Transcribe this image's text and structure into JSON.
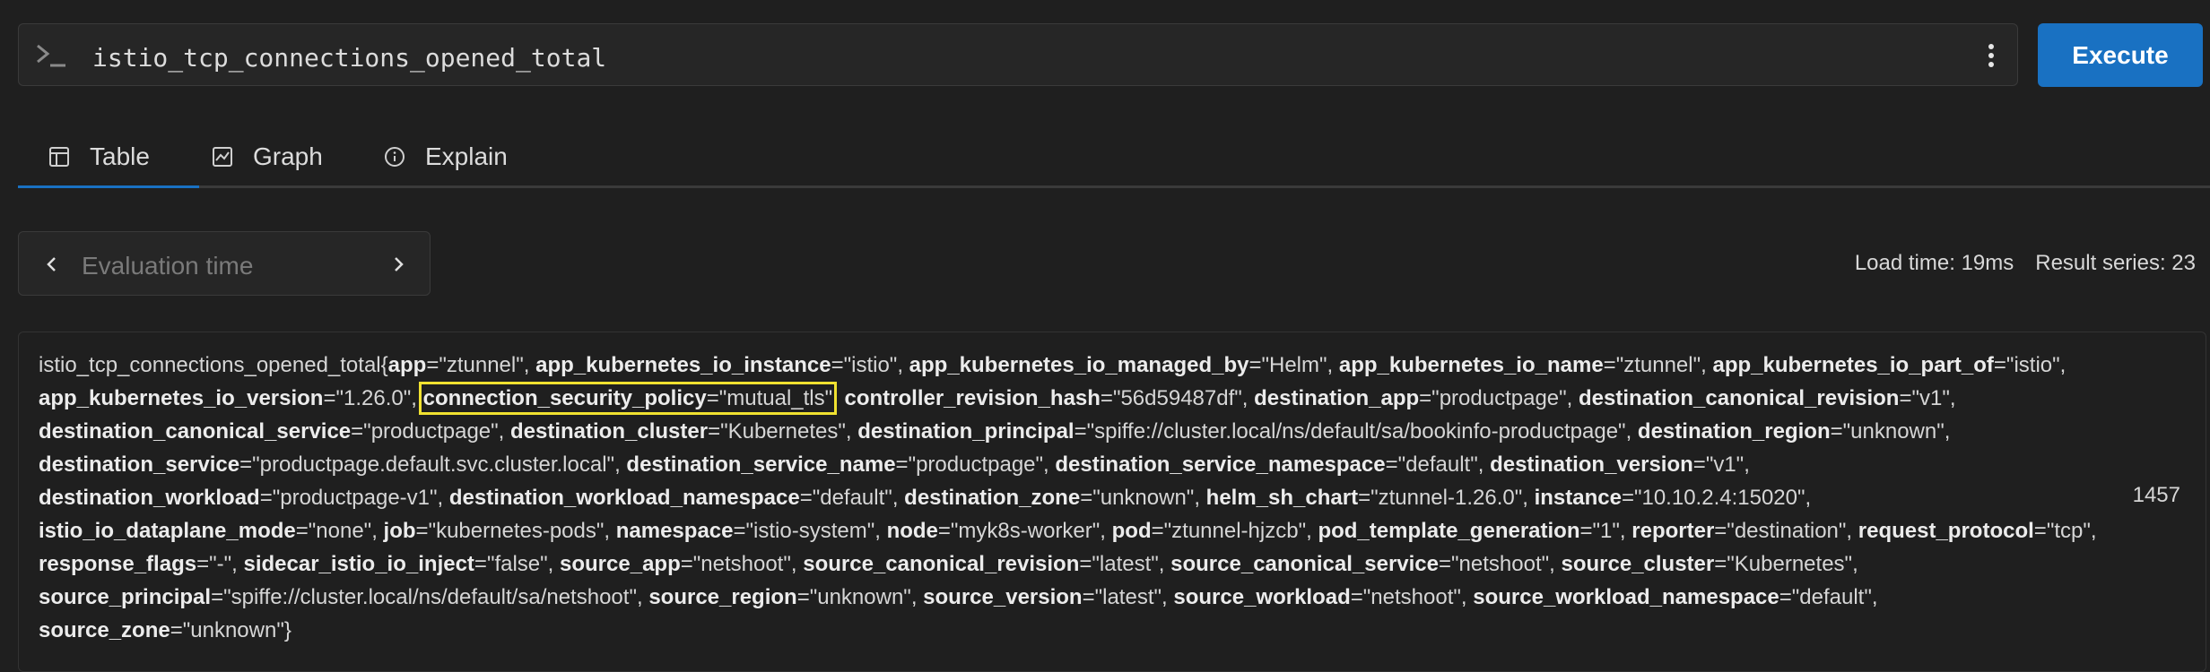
{
  "query": {
    "expression": "istio_tcp_connections_opened_total",
    "execute_label": "Execute"
  },
  "tabs": [
    {
      "label": "Table",
      "icon": "table-icon",
      "active": true
    },
    {
      "label": "Graph",
      "icon": "graph-icon",
      "active": false
    },
    {
      "label": "Explain",
      "icon": "info-icon",
      "active": false
    }
  ],
  "evaluation": {
    "placeholder": "Evaluation time"
  },
  "stats": {
    "load_time": "Load time: 19ms",
    "result_series": "Result series: 23"
  },
  "result": {
    "metric_name": "istio_tcp_connections_opened_total",
    "highlighted_label": "connection_security_policy",
    "highlight_color": "#f0e130",
    "value": "1457",
    "labels": [
      [
        "app",
        "ztunnel"
      ],
      [
        "app_kubernetes_io_instance",
        "istio"
      ],
      [
        "app_kubernetes_io_managed_by",
        "Helm"
      ],
      [
        "app_kubernetes_io_name",
        "ztunnel"
      ],
      [
        "app_kubernetes_io_part_of",
        "istio"
      ],
      [
        "app_kubernetes_io_version",
        "1.26.0"
      ],
      [
        "connection_security_policy",
        "mutual_tls"
      ],
      [
        "controller_revision_hash",
        "56d59487df"
      ],
      [
        "destination_app",
        "productpage"
      ],
      [
        "destination_canonical_revision",
        "v1"
      ],
      [
        "destination_canonical_service",
        "productpage"
      ],
      [
        "destination_cluster",
        "Kubernetes"
      ],
      [
        "destination_principal",
        "spiffe://cluster.local/ns/default/sa/bookinfo-productpage"
      ],
      [
        "destination_region",
        "unknown"
      ],
      [
        "destination_service",
        "productpage.default.svc.cluster.local"
      ],
      [
        "destination_service_name",
        "productpage"
      ],
      [
        "destination_service_namespace",
        "default"
      ],
      [
        "destination_version",
        "v1"
      ],
      [
        "destination_workload",
        "productpage-v1"
      ],
      [
        "destination_workload_namespace",
        "default"
      ],
      [
        "destination_zone",
        "unknown"
      ],
      [
        "helm_sh_chart",
        "ztunnel-1.26.0"
      ],
      [
        "instance",
        "10.10.2.4:15020"
      ],
      [
        "istio_io_dataplane_mode",
        "none"
      ],
      [
        "job",
        "kubernetes-pods"
      ],
      [
        "namespace",
        "istio-system"
      ],
      [
        "node",
        "myk8s-worker"
      ],
      [
        "pod",
        "ztunnel-hjzcb"
      ],
      [
        "pod_template_generation",
        "1"
      ],
      [
        "reporter",
        "destination"
      ],
      [
        "request_protocol",
        "tcp"
      ],
      [
        "response_flags",
        "-"
      ],
      [
        "sidecar_istio_io_inject",
        "false"
      ],
      [
        "source_app",
        "netshoot"
      ],
      [
        "source_canonical_revision",
        "latest"
      ],
      [
        "source_canonical_service",
        "netshoot"
      ],
      [
        "source_cluster",
        "Kubernetes"
      ],
      [
        "source_principal",
        "spiffe://cluster.local/ns/default/sa/netshoot"
      ],
      [
        "source_region",
        "unknown"
      ],
      [
        "source_version",
        "latest"
      ],
      [
        "source_workload",
        "netshoot"
      ],
      [
        "source_workload_namespace",
        "default"
      ],
      [
        "source_zone",
        "unknown"
      ]
    ]
  }
}
